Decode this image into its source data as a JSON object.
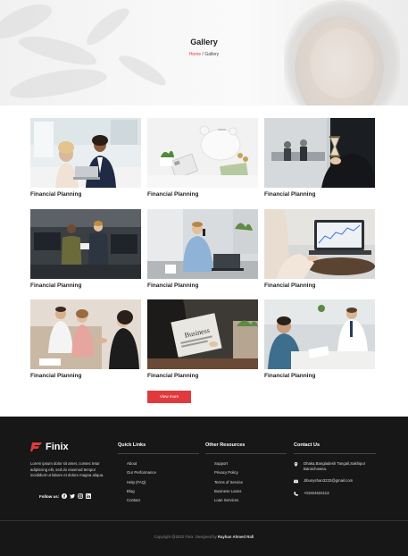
{
  "hero": {
    "title": "Gallery",
    "breadcrumb": {
      "home": "Home",
      "separator": "/",
      "current": "Gallery"
    }
  },
  "gallery": {
    "items": [
      {
        "caption": "Financial Planning",
        "image": "two people at laptop in office"
      },
      {
        "caption": "Financial Planning",
        "image": "piggy bank with calculator and plant"
      },
      {
        "caption": "Financial Planning",
        "image": "businessman holding hourglass"
      },
      {
        "caption": "Financial Planning",
        "image": "two men talking in office"
      },
      {
        "caption": "Financial Planning",
        "image": "man on phone at desk"
      },
      {
        "caption": "Financial Planning",
        "image": "laptop showing chart"
      },
      {
        "caption": "Financial Planning",
        "image": "couple shaking hands with advisor"
      },
      {
        "caption": "Financial Planning",
        "image": "man reading business newspaper"
      },
      {
        "caption": "Financial Planning",
        "image": "colleagues reviewing documents"
      }
    ],
    "view_more": "View more"
  },
  "footer": {
    "brand": "Finix",
    "about": "Lorem ipsum dolor sit amet, consec tetur adipiscing elit, sed do eiusmod tempor incididunt ut labore et dolore magna aliqua.",
    "follow_label": "Follow us:",
    "social": [
      "facebook-icon",
      "twitter-icon",
      "instagram-icon",
      "linkedin-icon"
    ],
    "quick_links": {
      "title": "Quick Links",
      "items": [
        "About",
        "Our Performance",
        "Help (FAQ)",
        "Blog",
        "Contact"
      ]
    },
    "other_resources": {
      "title": "Other Resources",
      "items": [
        "Support",
        "Privacy Policy",
        "Terms of Service",
        "Business Loans",
        "Loan Services"
      ]
    },
    "contact": {
      "title": "Contact Us",
      "address": "Dhaka,Bangladesh Tangail,Sakhipur Baroichowna.",
      "email": "Jibunyshan3232@gmail.com",
      "phone": "+01924624113"
    },
    "copyright_prefix": "Copyright @2022 Finix. Designed by",
    "designer": "Rayhan Ahmed Rafi"
  },
  "colors": {
    "accent": "#e03a3e",
    "footer_bg": "#171717"
  }
}
